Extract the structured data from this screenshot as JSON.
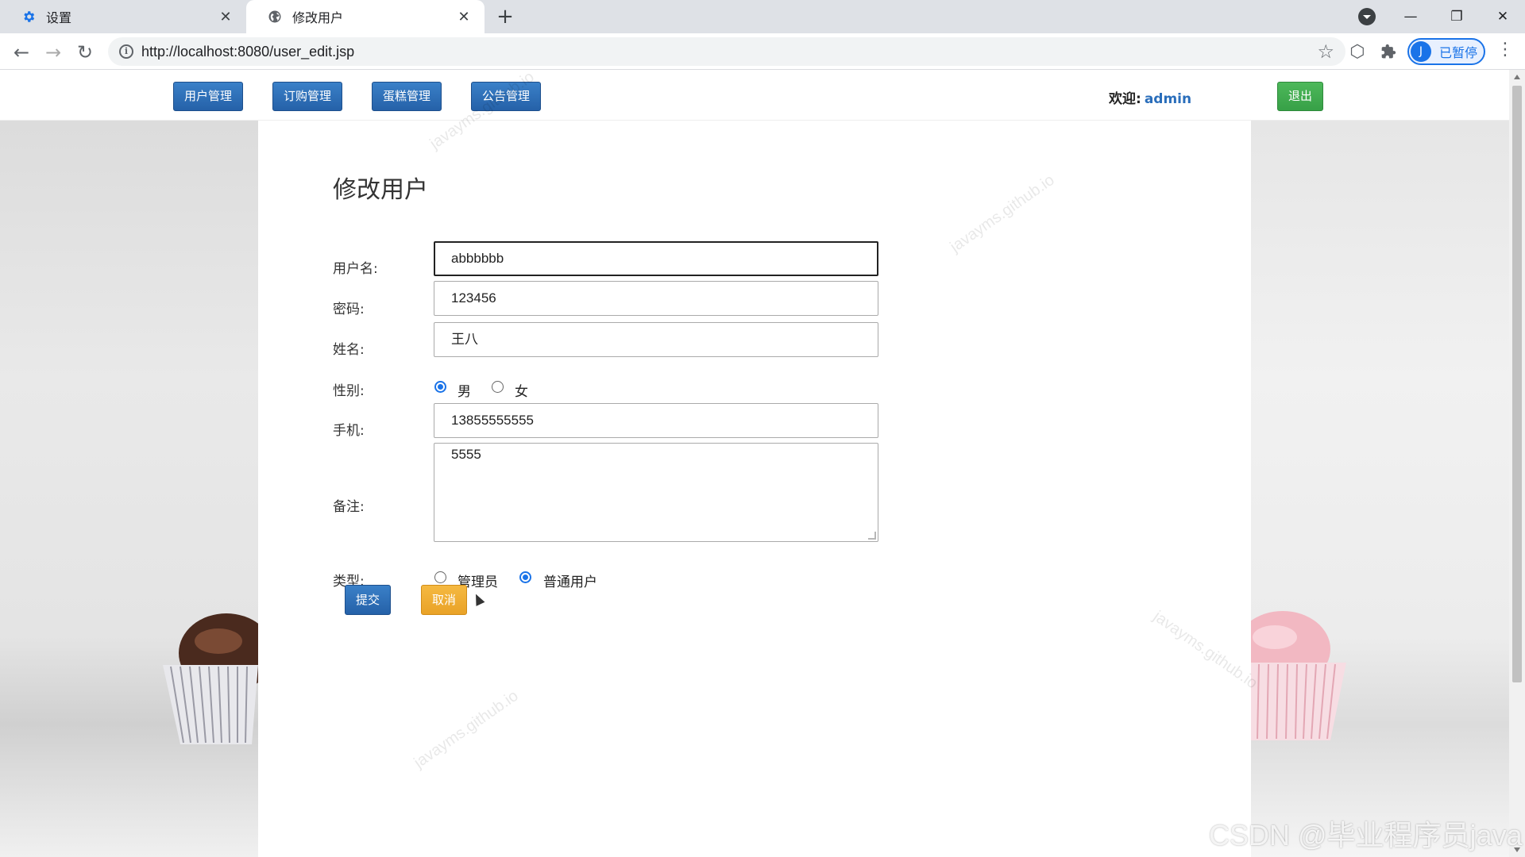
{
  "browser": {
    "tabs": [
      {
        "title": "设置",
        "icon": "gear-icon"
      },
      {
        "title": "修改用户",
        "icon": "globe-icon"
      }
    ],
    "url": "http://localhost:8080/user_edit.jsp",
    "profile": {
      "initial": "J",
      "label": "已暂停"
    }
  },
  "nav": {
    "items": [
      "用户管理",
      "订购管理",
      "蛋糕管理",
      "公告管理"
    ],
    "welcome_label": "欢迎:",
    "username": "admin",
    "logout_label": "退出"
  },
  "form": {
    "title": "修改用户",
    "username": {
      "label": "用户名:",
      "value": "abbbbbb"
    },
    "password": {
      "label": "密码:",
      "value": "123456"
    },
    "name": {
      "label": "姓名:",
      "value": "王八"
    },
    "gender": {
      "label": "性别:",
      "options": [
        "男",
        "女"
      ],
      "selected": "男"
    },
    "phone": {
      "label": "手机:",
      "value": "13855555555"
    },
    "remark": {
      "label": "备注:",
      "value": "5555"
    },
    "type": {
      "label": "类型:",
      "options": [
        "管理员",
        "普通用户"
      ],
      "selected": "普通用户"
    },
    "submit_label": "提交",
    "cancel_label": "取消"
  },
  "watermarks": [
    "javayms.github.io",
    "javayms.github.io",
    "javayms.github.io",
    "javayms.github.io"
  ],
  "csdn_watermark": "CSDN @毕业程序员java",
  "colors": {
    "primary": "#2a6ebb",
    "success": "#37a047",
    "warning": "#e9a227",
    "radio_checked": "#1a73e8"
  }
}
